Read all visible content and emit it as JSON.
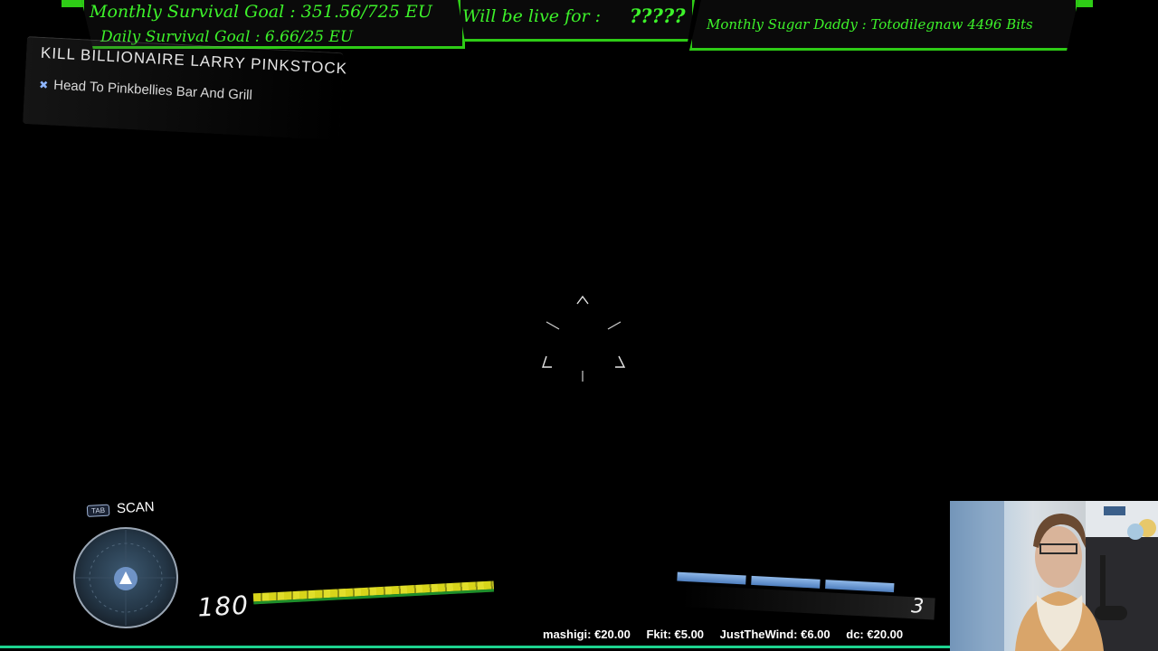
{
  "overlay": {
    "monthly_goal": "Monthly Survival Goal : 351.56/725 EU",
    "daily_goal": "Daily Survival Goal : 6.66/25 EU",
    "live_label": "Will be live for :",
    "live_value": "?????",
    "sugar_daddy": "Monthly Sugar Daddy : Totodilegnaw 4496 Bits",
    "accent_color": "#2ecc16",
    "text_color": "#3df22a"
  },
  "quest": {
    "title": "KILL BILLIONAIRE LARRY PINKSTOCK",
    "objective": "Head To Pinkbellies Bar And Grill",
    "objective_icon": "waypoint-icon"
  },
  "hud": {
    "scan_key": "TAB",
    "scan_label": "SCAN",
    "health_value": "180",
    "health_fraction": 1.0,
    "ammo_value": "3",
    "ammo_segments": 3,
    "radar_icon": "player-arrow-icon",
    "crosshair_icon": "crosshair-icon"
  },
  "ticker": {
    "items": [
      "mashigi: €20.00",
      "Fkit: €5.00",
      "JustTheWind: €6.00",
      "dc: €20.00"
    ],
    "line_color": "#1dd38f"
  },
  "webcam": {
    "icon": "webcam-feed"
  }
}
